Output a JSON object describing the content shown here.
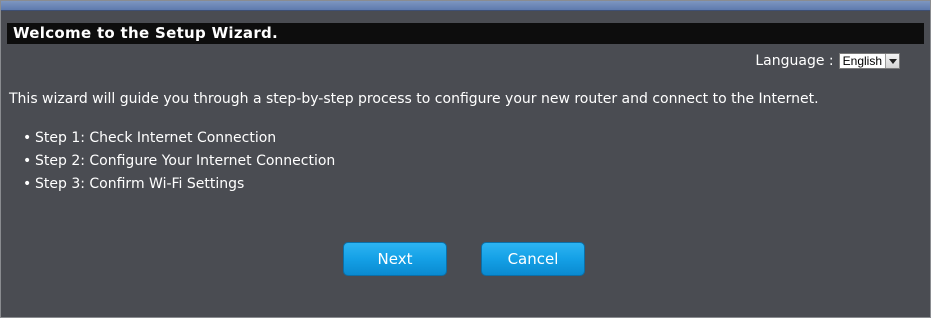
{
  "wizard": {
    "title": "Welcome to the Setup Wizard.",
    "language_label": "Language :",
    "language_selected": "English",
    "intro": "This wizard will guide you through a step-by-step process to configure your new router and connect to the Internet.",
    "steps": [
      "Step 1: Check Internet Connection",
      "Step 2: Configure Your Internet Connection",
      "Step 3: Confirm Wi-Fi Settings"
    ],
    "next_label": "Next",
    "cancel_label": "Cancel"
  },
  "colors": {
    "panel_bg": "#4a4c52",
    "title_bg": "#0d0d0d",
    "button_blue": "#14a0e6",
    "text": "#ffffff"
  }
}
